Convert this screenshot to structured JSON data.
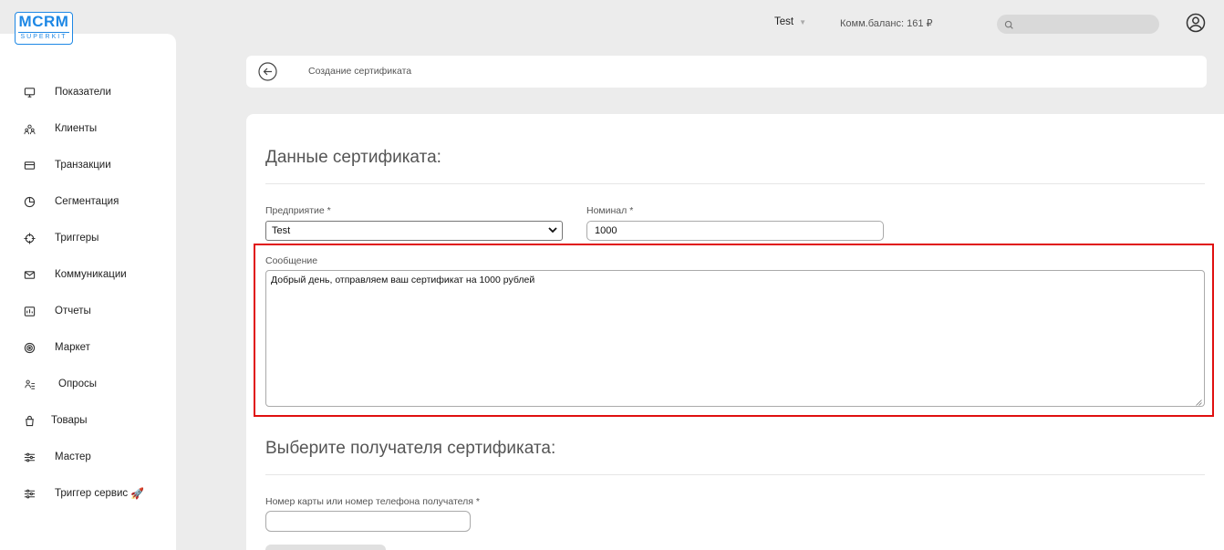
{
  "logo": {
    "main": "MCRM",
    "sub": "SUPERKIT"
  },
  "header": {
    "user": "Test",
    "balance": "Комм.баланс: 161 ₽",
    "search_placeholder": ""
  },
  "sidebar": {
    "items": [
      {
        "label": "Показатели",
        "icon": "monitor-icon"
      },
      {
        "label": "Клиенты",
        "icon": "users-icon"
      },
      {
        "label": "Транзакции",
        "icon": "card-icon"
      },
      {
        "label": "Сегментация",
        "icon": "pie-icon"
      },
      {
        "label": "Триггеры",
        "icon": "crosshair-icon"
      },
      {
        "label": "Коммуникации",
        "icon": "mail-icon"
      },
      {
        "label": "Отчеты",
        "icon": "report-icon"
      },
      {
        "label": "Маркет",
        "icon": "target-icon"
      },
      {
        "label": "Опросы",
        "icon": "survey-icon"
      },
      {
        "label": "Товары",
        "icon": "bag-icon"
      },
      {
        "label": "Мастер",
        "icon": "sliders-icon"
      },
      {
        "label": "Триггер сервис",
        "icon": "sliders-icon",
        "emoji": "🚀"
      }
    ]
  },
  "breadcrumb": {
    "title": "Создание сертификата"
  },
  "form": {
    "section1_title": "Данные сертификата:",
    "enterprise_label": "Предприятие *",
    "enterprise_value": "Test",
    "nominal_label": "Номинал *",
    "nominal_value": "1000",
    "message_label": "Сообщение",
    "message_value": "Добрый день, отправляем ваш сертификат на 1000 рублей",
    "section2_title": "Выберите получателя сертификата:",
    "recipient_label": "Номер карты или номер телефона получателя *",
    "recipient_value": ""
  },
  "colors": {
    "accent": "#1e88e5",
    "highlight": "#e01010",
    "background": "#ececec"
  }
}
